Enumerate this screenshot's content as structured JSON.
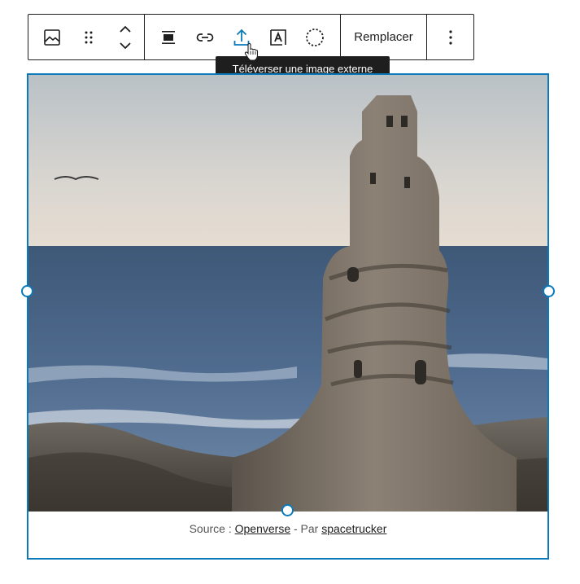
{
  "toolbar": {
    "group_block": [
      {
        "name": "image-icon",
        "label": "Image"
      },
      {
        "name": "drag-handle-icon",
        "label": "Drag"
      },
      {
        "name": "move-up-down-icon",
        "label": "Move up / down"
      }
    ],
    "group_tools": [
      {
        "name": "align-icon",
        "label": "Align"
      },
      {
        "name": "link-icon",
        "label": "Link"
      },
      {
        "name": "upload-icon",
        "label": "Upload external image",
        "active": true
      },
      {
        "name": "text-overlay-icon",
        "label": "Text over image"
      },
      {
        "name": "crop-circle-icon",
        "label": "Crop"
      }
    ],
    "replace_label": "Remplacer",
    "more_options_icon": "vertical-ellipsis-icon"
  },
  "tooltip": {
    "text": "Téléverser une image externe"
  },
  "image_block": {
    "image_alt": "sand-castle-on-beach-photo",
    "caption": {
      "prefix": "Source : ",
      "source_link": "Openverse",
      "separator": " - Par ",
      "author_link": "spacetrucker"
    }
  },
  "colors": {
    "accent": "#0a7aba",
    "active_icon": "#0a7aba",
    "text": "#1e1e1e",
    "tooltip_bg": "#1e1e1e"
  }
}
